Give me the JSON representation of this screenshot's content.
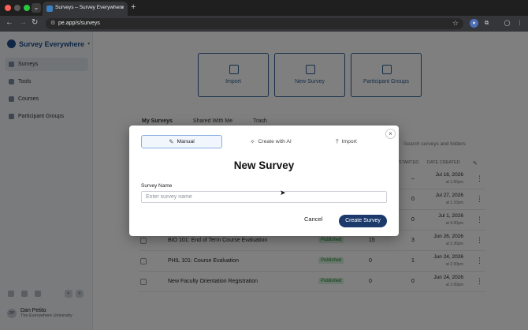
{
  "browser": {
    "tab_title": "Surveys – Survey Everywhere",
    "url": "pe.app/s/surveys"
  },
  "sidebar": {
    "brand": "Survey Everywhere",
    "items": [
      {
        "label": "Surveys"
      },
      {
        "label": "Tools"
      },
      {
        "label": "Courses"
      },
      {
        "label": "Participant Groups"
      }
    ],
    "user": {
      "name": "Dan Petito",
      "org": "The Everywhere University",
      "initials": "DP"
    }
  },
  "quick_actions": [
    {
      "label": "Import"
    },
    {
      "label": "New Survey"
    },
    {
      "label": "Participant Groups"
    }
  ],
  "list_tabs": [
    "My Surveys",
    "Shared With Me",
    "Trash"
  ],
  "search_placeholder": "Search surveys and folders",
  "table": {
    "headers": {
      "started": "STARTED",
      "date_created": "DATE CREATED"
    },
    "rows": [
      {
        "name": "",
        "status": "",
        "n1": "",
        "n2": "–",
        "date": "Jul 16, 2026",
        "time": "at 1:00pm"
      },
      {
        "name": "",
        "status": "",
        "n1": "",
        "n2": "0",
        "date": "Jul 27, 2026",
        "time": "at 1:10pm"
      },
      {
        "name": "",
        "status": "",
        "n1": "",
        "n2": "0",
        "date": "Jul 1, 2026",
        "time": "at 4:30pm"
      },
      {
        "name": "BIO 101: End of Term Course Evaluation",
        "status": "Published",
        "n1": "15",
        "n2": "3",
        "date": "Jun 26, 2026",
        "time": "at 1:30pm"
      },
      {
        "name": "PHIL 101: Course Evaluation",
        "status": "Published",
        "n1": "0",
        "n2": "1",
        "date": "Jun 24, 2026",
        "time": "at 2:30pm"
      },
      {
        "name": "New Faculty Orientation Registration",
        "status": "Published",
        "n1": "0",
        "n2": "0",
        "date": "Jun 24, 2026",
        "time": "at 1:00pm"
      }
    ]
  },
  "modal": {
    "tabs": [
      {
        "label": "Manual",
        "icon": "pencil-icon"
      },
      {
        "label": "Create with AI",
        "icon": "sparkle-icon"
      },
      {
        "label": "Import",
        "icon": "upload-icon"
      }
    ],
    "title": "New Survey",
    "field_label": "Survey Name",
    "field_placeholder": "Enter survey name",
    "field_value": "",
    "cancel_label": "Cancel",
    "create_label": "Create Survey",
    "close_glyph": "×"
  }
}
